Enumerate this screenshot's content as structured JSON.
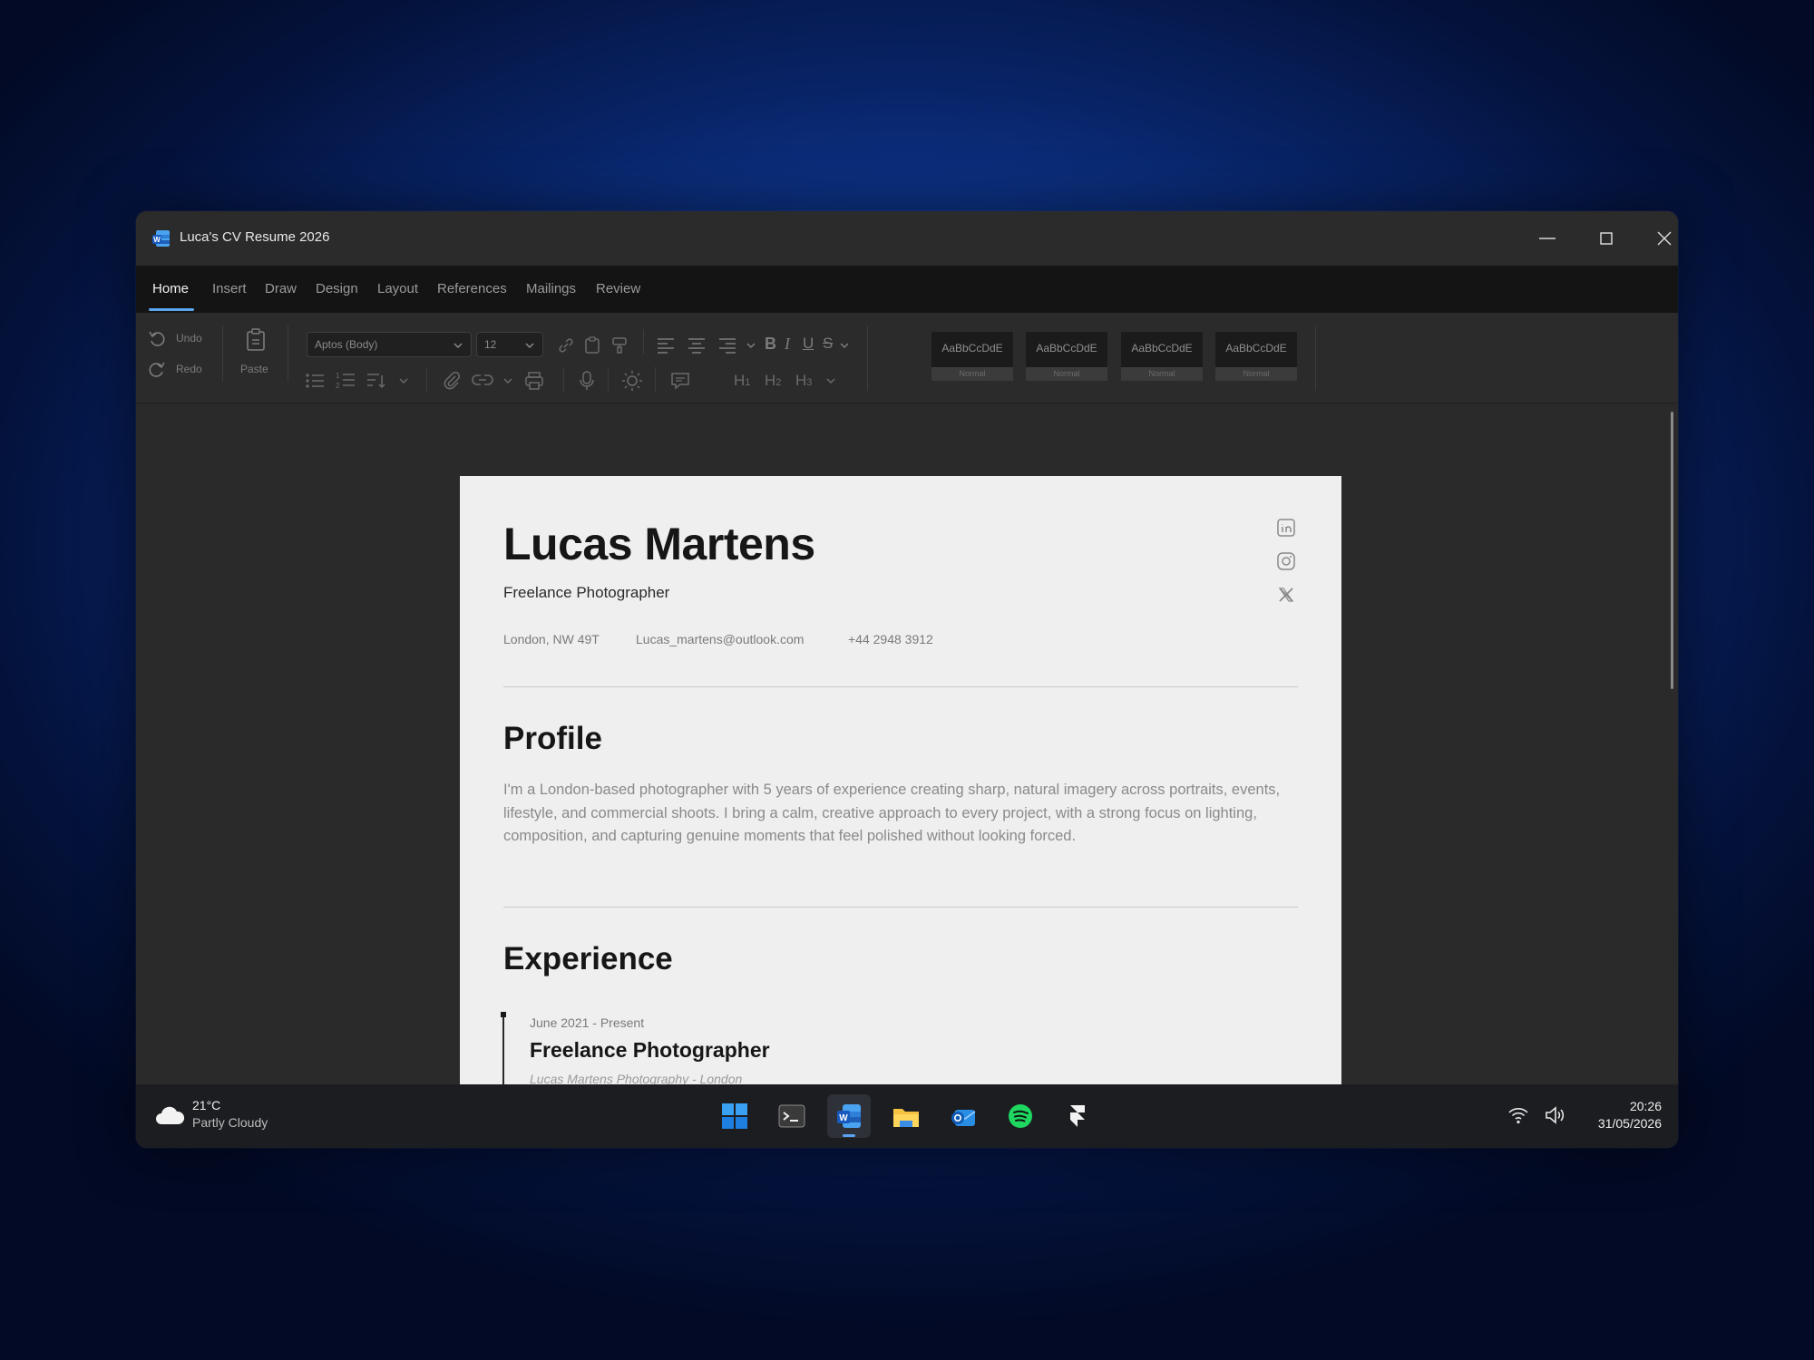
{
  "window": {
    "title": "Luca's CV Resume 2026"
  },
  "menu": {
    "tabs": [
      "Home",
      "Insert",
      "Draw",
      "Design",
      "Layout",
      "References",
      "Mailings",
      "Review"
    ],
    "active": "Home"
  },
  "ribbon": {
    "undo_label": "Undo",
    "redo_label": "Redo",
    "paste_label": "Paste",
    "font_family": "Aptos (Body)",
    "font_size": "12",
    "styles": [
      {
        "sample": "AaBbCcDdE",
        "name": "Normal"
      },
      {
        "sample": "AaBbCcDdE",
        "name": "Normal"
      },
      {
        "sample": "AaBbCcDdE",
        "name": "Normal"
      },
      {
        "sample": "AaBbCcDdE",
        "name": "Normal"
      }
    ]
  },
  "document": {
    "name": "Lucas Martens",
    "role": "Freelance Photographer",
    "location": "London, NW 49T",
    "email": "Lucas_martens@outlook.com",
    "phone": "+44 2948 3912",
    "social_icons": [
      "linkedin-icon",
      "instagram-icon",
      "x-icon"
    ],
    "profile_heading": "Profile",
    "profile_text": "I'm a London-based photographer with 5 years of experience creating sharp, natural imagery across portraits, events, lifestyle, and commercial shoots. I bring a calm, creative approach to every project, with a strong focus on lighting, composition, and capturing genuine moments that feel polished without looking forced.",
    "experience_heading": "Experience",
    "experience": [
      {
        "date": "June 2021 - Present",
        "title": "Freelance Photographer",
        "company": "Lucas Martens Photography - London"
      }
    ]
  },
  "taskbar": {
    "weather_temp": "21°C",
    "weather_desc": "Partly Cloudy",
    "apps": [
      "start-icon",
      "terminal-icon",
      "word-icon",
      "file-explorer-icon",
      "outlook-icon",
      "spotify-icon",
      "framer-icon"
    ],
    "active_app": "word-icon",
    "time": "20:26",
    "date": "31/05/2026"
  },
  "colors": {
    "accent": "#5aa7ee",
    "spotify": "#1ed760",
    "explorer": "#f5c242"
  }
}
